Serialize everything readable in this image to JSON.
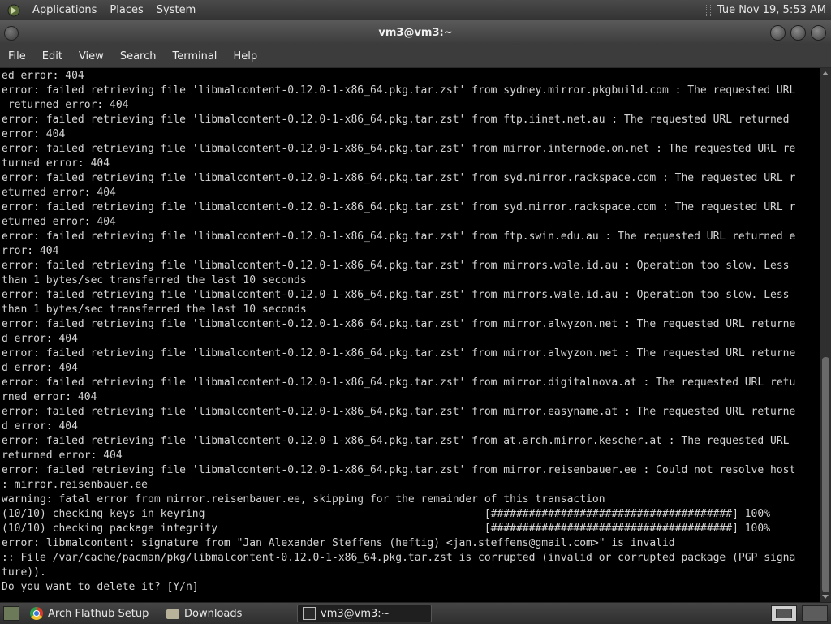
{
  "top_panel": {
    "menus": [
      "Applications",
      "Places",
      "System"
    ],
    "clock": "Tue Nov 19,  5:53 AM"
  },
  "window": {
    "title": "vm3@vm3:~"
  },
  "menubar": {
    "items": [
      "File",
      "Edit",
      "View",
      "Search",
      "Terminal",
      "Help"
    ]
  },
  "terminal": {
    "lines": [
      "ed error: 404",
      "error: failed retrieving file 'libmalcontent-0.12.0-1-x86_64.pkg.tar.zst' from sydney.mirror.pkgbuild.com : The requested URL",
      " returned error: 404",
      "error: failed retrieving file 'libmalcontent-0.12.0-1-x86_64.pkg.tar.zst' from ftp.iinet.net.au : The requested URL returned",
      "error: 404",
      "error: failed retrieving file 'libmalcontent-0.12.0-1-x86_64.pkg.tar.zst' from mirror.internode.on.net : The requested URL re",
      "turned error: 404",
      "error: failed retrieving file 'libmalcontent-0.12.0-1-x86_64.pkg.tar.zst' from syd.mirror.rackspace.com : The requested URL r",
      "eturned error: 404",
      "error: failed retrieving file 'libmalcontent-0.12.0-1-x86_64.pkg.tar.zst' from syd.mirror.rackspace.com : The requested URL r",
      "eturned error: 404",
      "error: failed retrieving file 'libmalcontent-0.12.0-1-x86_64.pkg.tar.zst' from ftp.swin.edu.au : The requested URL returned e",
      "rror: 404",
      "error: failed retrieving file 'libmalcontent-0.12.0-1-x86_64.pkg.tar.zst' from mirrors.wale.id.au : Operation too slow. Less",
      "than 1 bytes/sec transferred the last 10 seconds",
      "error: failed retrieving file 'libmalcontent-0.12.0-1-x86_64.pkg.tar.zst' from mirrors.wale.id.au : Operation too slow. Less",
      "than 1 bytes/sec transferred the last 10 seconds",
      "error: failed retrieving file 'libmalcontent-0.12.0-1-x86_64.pkg.tar.zst' from mirror.alwyzon.net : The requested URL returne",
      "d error: 404",
      "error: failed retrieving file 'libmalcontent-0.12.0-1-x86_64.pkg.tar.zst' from mirror.alwyzon.net : The requested URL returne",
      "d error: 404",
      "error: failed retrieving file 'libmalcontent-0.12.0-1-x86_64.pkg.tar.zst' from mirror.digitalnova.at : The requested URL retu",
      "rned error: 404",
      "error: failed retrieving file 'libmalcontent-0.12.0-1-x86_64.pkg.tar.zst' from mirror.easyname.at : The requested URL returne",
      "d error: 404",
      "error: failed retrieving file 'libmalcontent-0.12.0-1-x86_64.pkg.tar.zst' from at.arch.mirror.kescher.at : The requested URL",
      "returned error: 404",
      "error: failed retrieving file 'libmalcontent-0.12.0-1-x86_64.pkg.tar.zst' from mirror.reisenbauer.ee : Could not resolve host",
      ": mirror.reisenbauer.ee",
      "warning: fatal error from mirror.reisenbauer.ee, skipping for the remainder of this transaction",
      "(10/10) checking keys in keyring                                            [######################################] 100%",
      "(10/10) checking package integrity                                          [######################################] 100%",
      "error: libmalcontent: signature from \"Jan Alexander Steffens (heftig) <jan.steffens@gmail.com>\" is invalid",
      ":: File /var/cache/pacman/pkg/libmalcontent-0.12.0-1-x86_64.pkg.tar.zst is corrupted (invalid or corrupted package (PGP signa",
      "ture)).",
      "Do you want to delete it? [Y/n]"
    ]
  },
  "taskbar": {
    "tasks": [
      {
        "label": "Arch Flathub Setup |...",
        "icon": "chrome-icon"
      },
      {
        "label": "Downloads",
        "icon": "folder-icon"
      },
      {
        "label": "vm3@vm3:~",
        "icon": "terminal-icon"
      }
    ]
  }
}
